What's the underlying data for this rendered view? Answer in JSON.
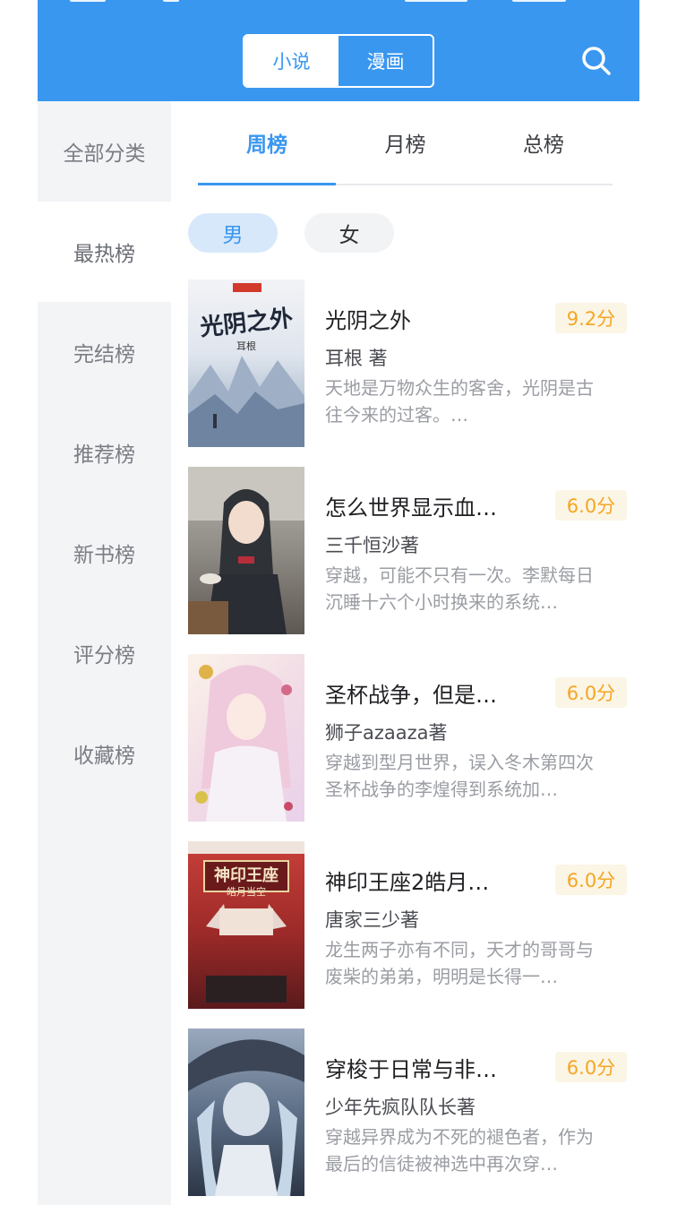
{
  "header": {
    "segment": {
      "novel": "小说",
      "comic": "漫画"
    }
  },
  "sidebar": {
    "items": [
      {
        "label": "全部分类"
      },
      {
        "label": "最热榜"
      },
      {
        "label": "完结榜"
      },
      {
        "label": "推荐榜"
      },
      {
        "label": "新书榜"
      },
      {
        "label": "评分榜"
      },
      {
        "label": "收藏榜"
      }
    ]
  },
  "tabs": [
    {
      "label": "周榜"
    },
    {
      "label": "月榜"
    },
    {
      "label": "总榜"
    }
  ],
  "gender": {
    "male": "男",
    "female": "女"
  },
  "books": [
    {
      "title": "光阴之外",
      "score": "9.2分",
      "author": "耳根 著",
      "desc": "天地是万物众生的客舍，光阴是古往今来的过客。…",
      "cover_text": "光阴之外",
      "cover_sub": "耳根"
    },
    {
      "title": "怎么世界显示血…",
      "score": "6.0分",
      "author": "三千恒沙著",
      "desc": "穿越，可能不只有一次。李默每日沉睡十六个小时换来的系统…",
      "cover_text": "",
      "cover_sub": ""
    },
    {
      "title": "圣杯战争，但是…",
      "score": "6.0分",
      "author": "狮子azaaza著",
      "desc": "穿越到型月世界，误入冬木第四次圣杯战争的李煌得到系统加…",
      "cover_text": "",
      "cover_sub": ""
    },
    {
      "title": "神印王座2皓月…",
      "score": "6.0分",
      "author": "唐家三少著",
      "desc": "龙生两子亦有不同，天才的哥哥与废柴的弟弟，明明是长得一…",
      "cover_text": "神印王座",
      "cover_sub": "皓月当空"
    },
    {
      "title": "穿梭于日常与非…",
      "score": "6.0分",
      "author": "少年先疯队队长著",
      "desc": "穿越异界成为不死的褪色者，作为最后的信徒被神选中再次穿…",
      "cover_text": "",
      "cover_sub": ""
    }
  ],
  "colors": {
    "primary": "#3a97f0",
    "score": "#f5a623",
    "score_bg": "#fbf5e6",
    "sidebar_bg": "#f3f4f6"
  }
}
